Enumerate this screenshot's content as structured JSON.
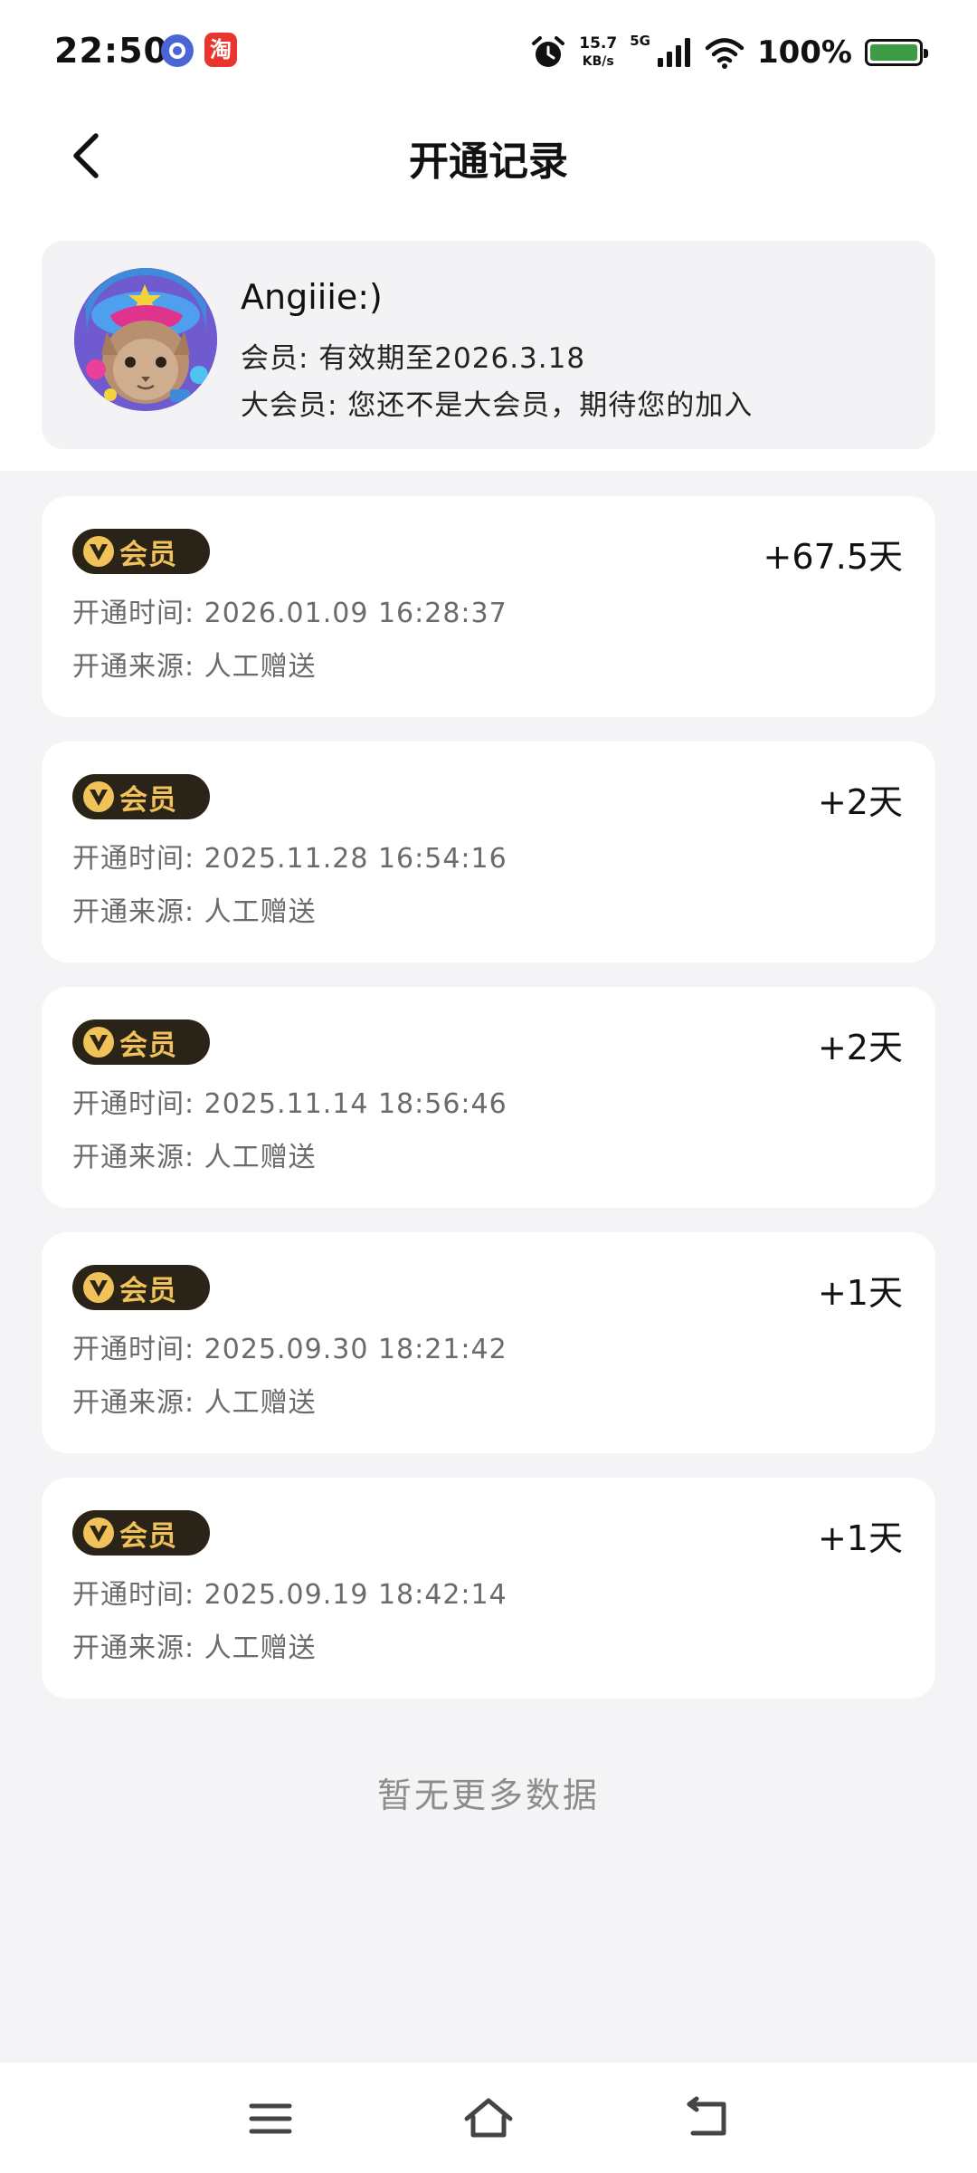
{
  "status_bar": {
    "time": "22:50",
    "app_icon_2_glyph": "淘",
    "net_speed_value": "15.7",
    "net_speed_unit": "KB/s",
    "network": "5G",
    "battery_percent": "100%"
  },
  "header": {
    "title": "开通记录"
  },
  "profile": {
    "name": "Angiiie:)",
    "membership": "会员: 有效期至2026.3.18",
    "big_membership": "大会员: 您还不是大会员，期待您的加入"
  },
  "records": [
    {
      "badge": "会员",
      "amount": "+67.5天",
      "time": "开通时间: 2026.01.09 16:28:37",
      "source": "开通来源:  人工赠送"
    },
    {
      "badge": "会员",
      "amount": "+2天",
      "time": "开通时间: 2025.11.28 16:54:16",
      "source": "开通来源:  人工赠送"
    },
    {
      "badge": "会员",
      "amount": "+2天",
      "time": "开通时间: 2025.11.14 18:56:46",
      "source": "开通来源:  人工赠送"
    },
    {
      "badge": "会员",
      "amount": "+1天",
      "time": "开通时间: 2025.09.30 18:21:42",
      "source": "开通来源:  人工赠送"
    },
    {
      "badge": "会员",
      "amount": "+1天",
      "time": "开通时间: 2025.09.19 18:42:14",
      "source": "开通来源:  人工赠送"
    }
  ],
  "footer": {
    "no_more": "暂无更多数据"
  },
  "icons": {
    "back": "chevron-left-icon",
    "alarm": "alarm-clock-icon",
    "signal": "signal-bars-icon",
    "wifi": "wifi-icon",
    "battery": "battery-icon",
    "nav_menu": "menu-icon",
    "nav_home": "home-icon",
    "nav_back": "back-arrow-icon",
    "vip": "vip-v-icon"
  },
  "colors": {
    "badge_bg": "#2a2418",
    "badge_text": "#f2c25a",
    "battery_fill": "#3e9b45",
    "page_bg": "#f4f4f6"
  }
}
